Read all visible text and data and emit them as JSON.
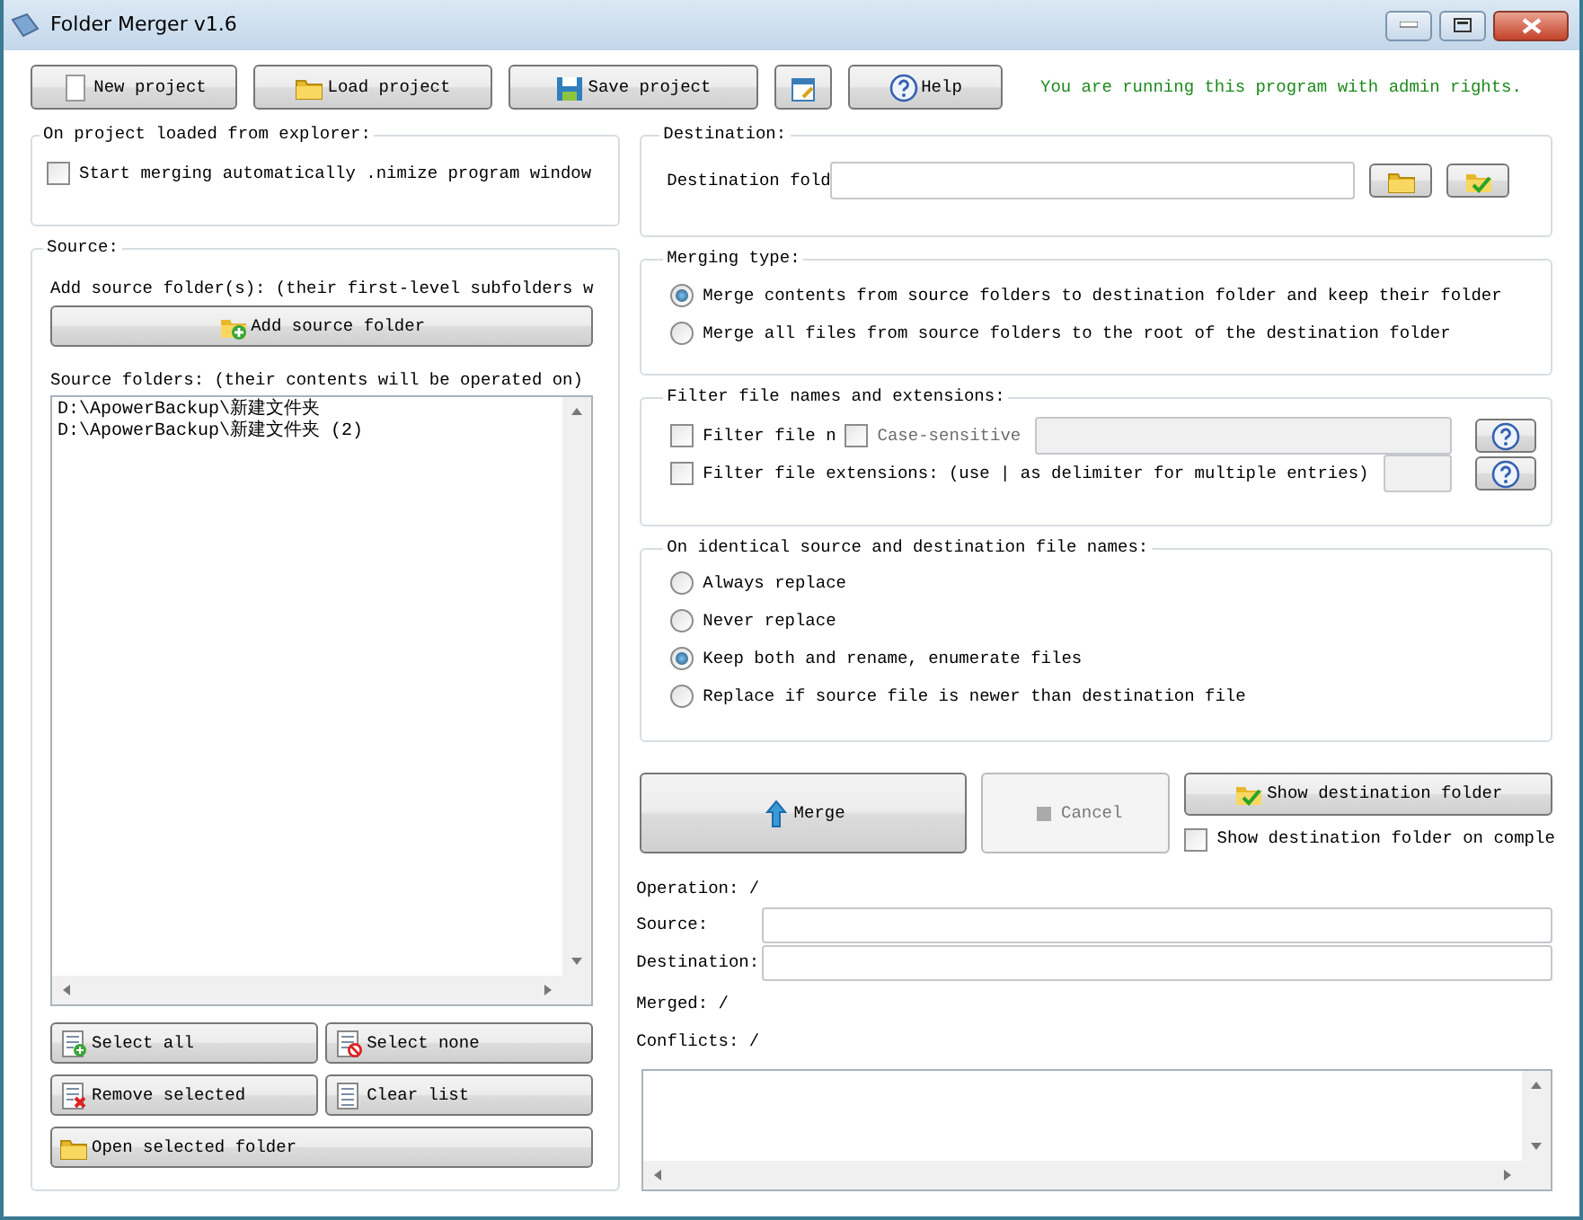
{
  "window": {
    "title": "Folder Merger v1.6"
  },
  "toolbar": {
    "buttons": [
      {
        "label": "New project"
      },
      {
        "label": "Load project"
      },
      {
        "label": "Save project"
      },
      {
        "label": "Help"
      }
    ],
    "notice": "You are running this program with admin rights."
  },
  "on_project_loaded": {
    "title": "On project loaded from explorer:",
    "option": {
      "label": "Start merging automatically .nimize program window",
      "checked": false
    }
  },
  "source": {
    "title": "Source:",
    "add_hint": "Add source folder(s): (their first-level subfolders w",
    "add_button": {
      "label": "Add source folder"
    },
    "list_label": "Source folders: (their contents will be operated on)",
    "folders": [
      "D:\\ApowerBackup\\新建文件夹",
      "D:\\ApowerBackup\\新建文件夹 (2)"
    ],
    "buttons": [
      {
        "label": "Select all"
      },
      {
        "label": "Select none"
      },
      {
        "label": "Remove selected"
      },
      {
        "label": "Clear list"
      },
      {
        "label": "Open selected folder"
      }
    ]
  },
  "destination": {
    "title": "Destination:",
    "label": "Destination fold"
  },
  "merging_type": {
    "title": "Merging type:",
    "options": [
      {
        "label": "Merge contents from source folders to destination folder and keep their folder",
        "selected": true
      },
      {
        "label": "Merge all files from source folders to the root of the destination folder",
        "selected": false
      }
    ]
  },
  "filter": {
    "title": "Filter file names and extensions:",
    "rows": [
      {
        "label": "Filter file n",
        "checked": false,
        "case_sensitive": {
          "label": "Case-sensitive",
          "checked": false
        }
      },
      {
        "label": "Filter file extensions: (use | as delimiter for multiple entries)",
        "checked": false
      }
    ]
  },
  "identical": {
    "title": "On identical source and destination file names:",
    "options": [
      {
        "label": "Always replace",
        "selected": false
      },
      {
        "label": "Never replace",
        "selected": false
      },
      {
        "label": "Keep both and rename, enumerate files",
        "selected": true
      },
      {
        "label": "Replace if source file is newer than destination file",
        "selected": false
      }
    ]
  },
  "actions": {
    "merge": {
      "label": "Merge",
      "disabled": false
    },
    "cancel": {
      "label": "Cancel",
      "disabled": true
    },
    "show_destination": {
      "label": "Show destination folder"
    },
    "show_on_complete": {
      "label": "Show destination folder on comple",
      "checked": false
    }
  },
  "status": {
    "operation": "Operation: /",
    "source_label": "Source:",
    "destination_label": "Destination:",
    "merged": "Merged: /",
    "conflicts": "Conflicts: /"
  }
}
